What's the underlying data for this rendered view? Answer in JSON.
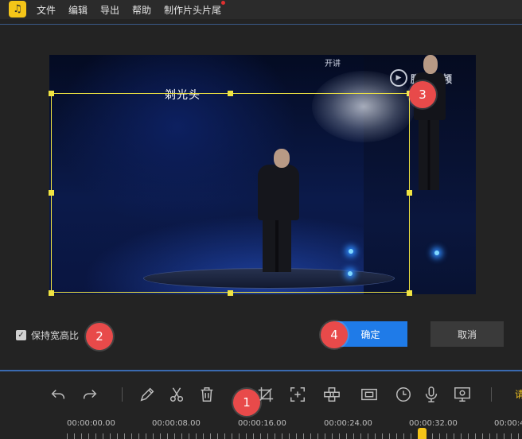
{
  "app": {
    "logo_icon": "app-logo-icon",
    "accent": "#f5c518"
  },
  "menu": {
    "items": [
      "文件",
      "编辑",
      "导出",
      "帮助",
      "制作片头片尾"
    ],
    "new_indicator_color": "#e03030"
  },
  "preview": {
    "video_caption": "剃光头",
    "watermark_text": "腾讯视频",
    "corner_logo_text": "开讲"
  },
  "crop": {
    "keep_ratio_label": "保持宽高比",
    "keep_ratio_checked": true,
    "confirm_label": "确定",
    "cancel_label": "取消",
    "box_color": "#f0e442"
  },
  "badges": [
    "1",
    "2",
    "3",
    "4"
  ],
  "toolbar": {
    "tools": [
      "undo-icon",
      "redo-icon",
      "pencil-icon",
      "scissors-icon",
      "trash-icon",
      "crop-icon",
      "zoom-icon",
      "mosaic-icon",
      "frame-icon",
      "clock-icon",
      "microphone-icon",
      "screen-record-icon"
    ],
    "more_label": "请"
  },
  "timeline": {
    "timestamps": [
      "00:00:00.00",
      "00:00:08.00",
      "00:00:16.00",
      "00:00:24.00",
      "00:00:32.00",
      "00:00:4"
    ],
    "playhead_color": "#f5c518"
  }
}
